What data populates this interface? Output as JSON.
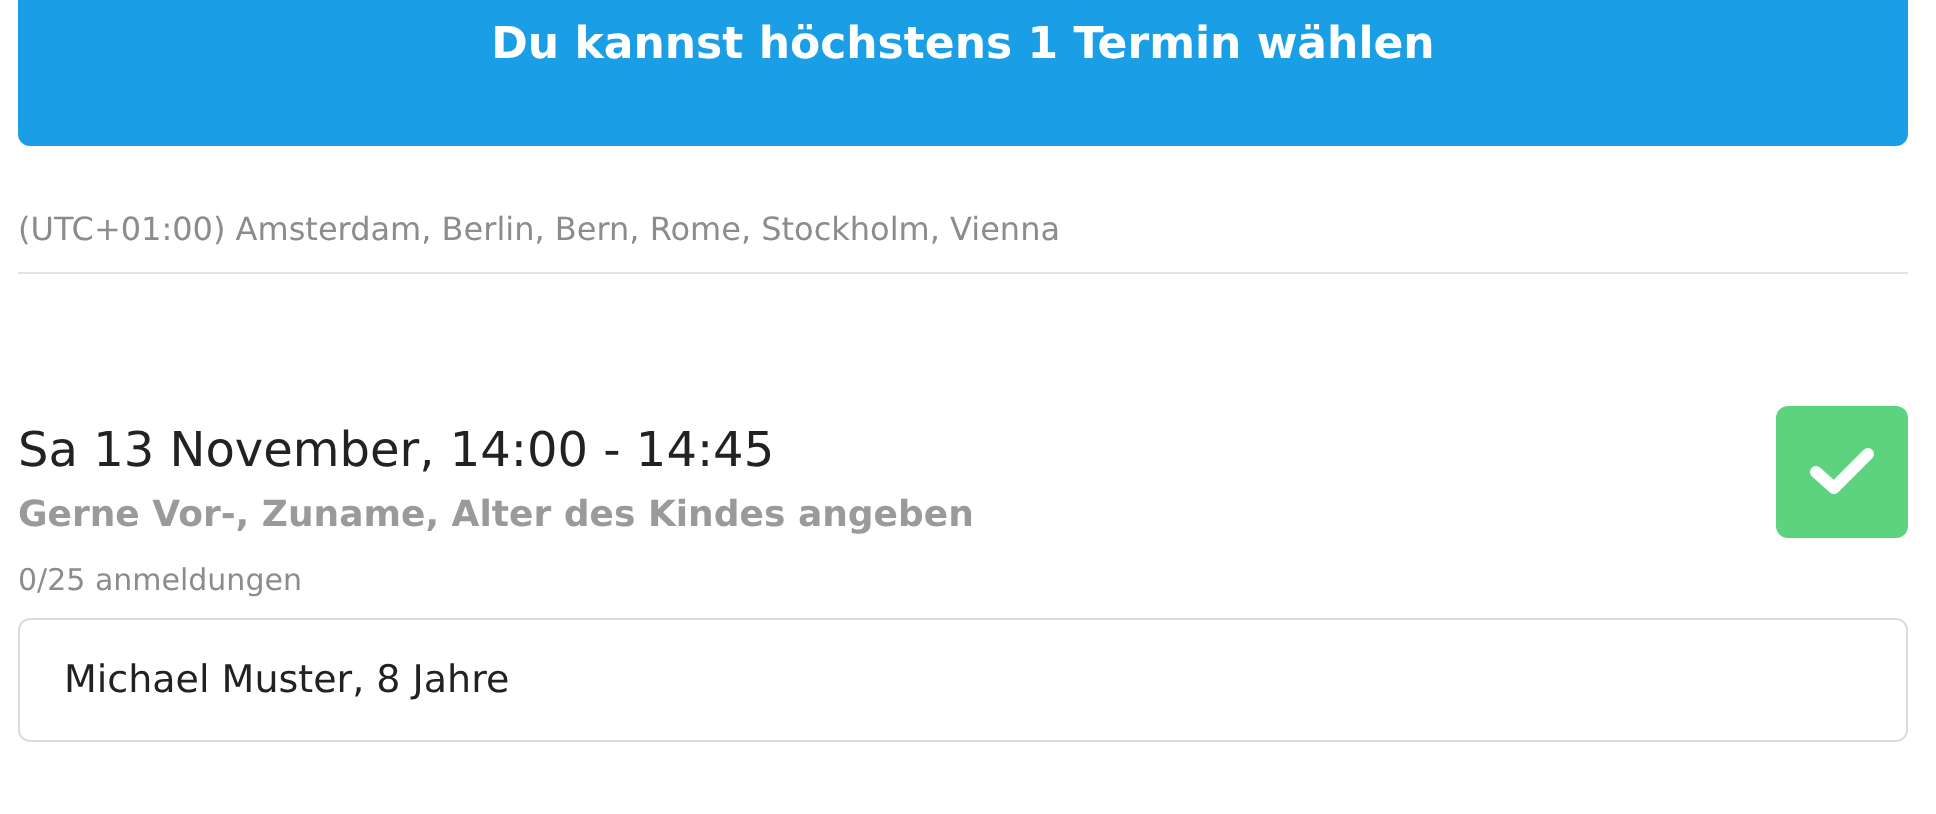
{
  "banner": {
    "text": "Du kannst höchstens 1 Termin wählen"
  },
  "timezone": "(UTC+01:00) Amsterdam, Berlin, Bern, Rome, Stockholm, Vienna",
  "slots": [
    {
      "title": "Sa 13 November, 14:00 - 14:45",
      "subtitle": "Gerne Vor-, Zuname, Alter des Kindes angeben",
      "count": "0/25 anmeldungen",
      "checked": true,
      "value": "Michael Muster, 8 Jahre"
    }
  ]
}
